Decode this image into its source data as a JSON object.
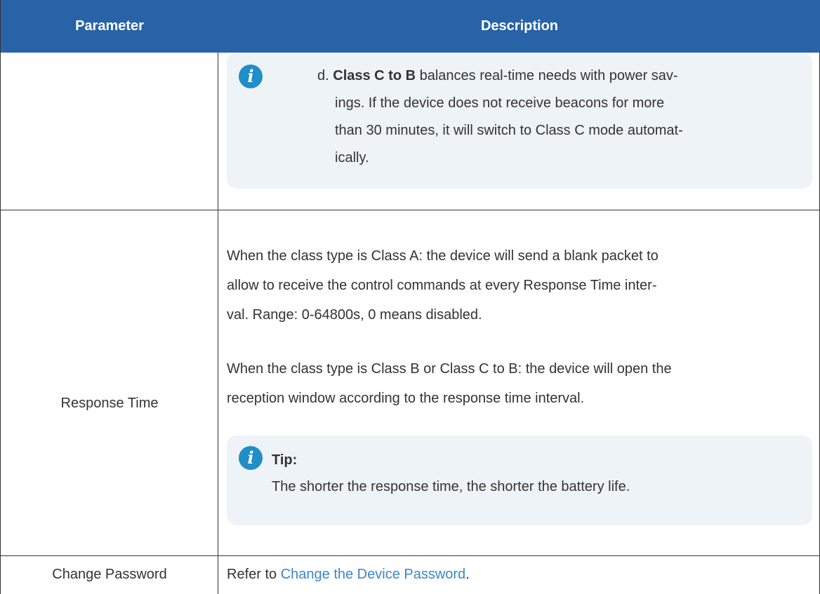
{
  "header": {
    "parameter": "Parameter",
    "description": "Description"
  },
  "class_note": {
    "marker": "d.",
    "bold": "Class C to B",
    "line1_rest": " balances real-time needs with power sav-",
    "line2": "ings. If the device does not receive beacons for more",
    "line3": "than 30 minutes, it will switch to Class C mode automat-",
    "line4": "ically."
  },
  "response_time": {
    "param": "Response Time",
    "p1_l1": "When the class type is Class A: the device will send a blank packet to",
    "p1_l2": "allow to receive the control commands at every Response Time inter-",
    "p1_l3": "val. Range: 0-64800s, 0 means disabled.",
    "p2_l1": "When the class type is Class B or Class C to B: the device will open the",
    "p2_l2": "reception window according to the response time interval.",
    "tip_title": "Tip:",
    "tip_text": "The shorter the response time, the shorter the battery life."
  },
  "change_password": {
    "param": "Change Password",
    "prefix": "Refer to ",
    "link": "Change the Device Password",
    "suffix": "."
  },
  "colors": {
    "header_bg": "#2863a8",
    "note_bg": "#eef3f8",
    "icon": "#1f8ec9",
    "link": "#3a87c8"
  },
  "icons": {
    "info": "info-icon"
  }
}
